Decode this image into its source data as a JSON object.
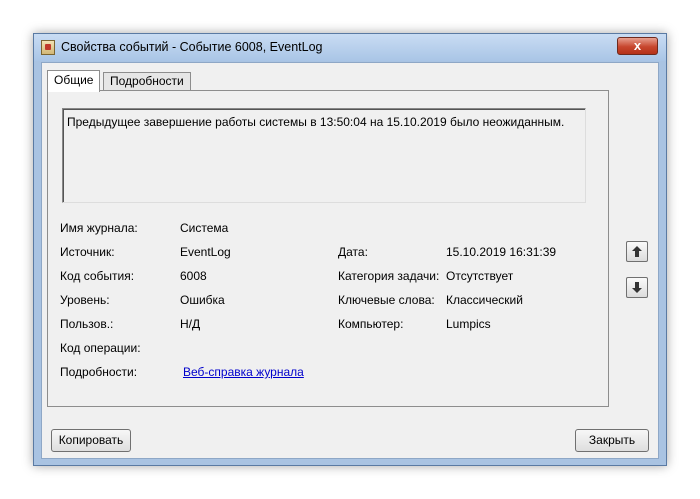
{
  "window": {
    "title": "Свойства событий - Событие 6008, EventLog",
    "close_label": "x"
  },
  "tabs": [
    {
      "label": "Общие",
      "active": true
    },
    {
      "label": "Подробности",
      "active": false
    }
  ],
  "description": "Предыдущее завершение работы системы в 13:50:04 на 15.10.2019 было неожиданным.",
  "fields_left": [
    {
      "label": "Имя журнала:",
      "value": "Система"
    },
    {
      "label": "Источник:",
      "value": "EventLog"
    },
    {
      "label": "Код события:",
      "value": "6008"
    },
    {
      "label": "Уровень:",
      "value": "Ошибка"
    },
    {
      "label": "Пользов.:",
      "value": "Н/Д"
    },
    {
      "label": "Код операции:",
      "value": ""
    },
    {
      "label": "Подробности:",
      "value": "Веб-справка журнала"
    }
  ],
  "fields_right": [
    {
      "label": "Дата:",
      "value": "15.10.2019 16:31:39"
    },
    {
      "label": "Категория задачи:",
      "value": "Отсутствует"
    },
    {
      "label": "Ключевые слова:",
      "value": "Классический"
    },
    {
      "label": "Компьютер:",
      "value": "Lumpics"
    }
  ],
  "buttons": {
    "copy": "Копировать",
    "close": "Закрыть"
  },
  "icons": {
    "up": "arrow-up-icon",
    "down": "arrow-down-icon"
  }
}
